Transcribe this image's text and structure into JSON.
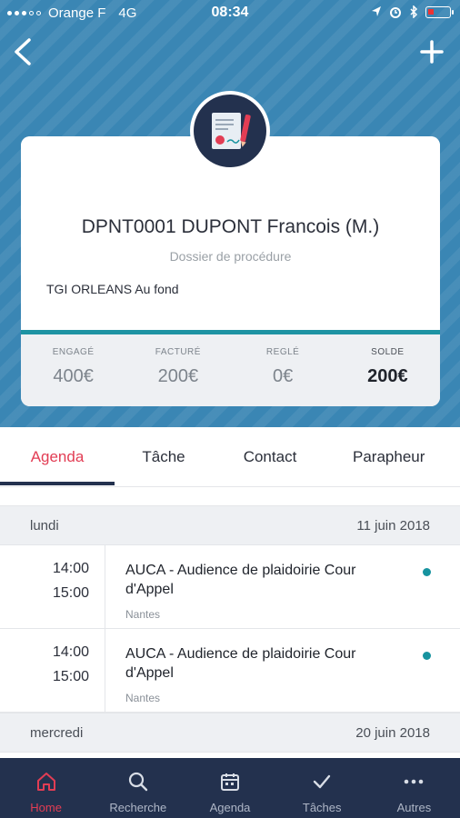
{
  "status_bar": {
    "carrier": "Orange F",
    "network": "4G",
    "time": "08:34"
  },
  "header": {
    "back_icon": "chevron-left-icon",
    "add_icon": "plus-icon",
    "avatar_icon": "document-signature-icon"
  },
  "dossier": {
    "title": "DPNT0001 DUPONT Francois (M.)",
    "type": "Dossier de procédure",
    "court": "TGI ORLEANS Au fond",
    "stats": [
      {
        "label": "ENGAGÉ",
        "value": "400€"
      },
      {
        "label": "FACTURÉ",
        "value": "200€"
      },
      {
        "label": "REGLÉ",
        "value": "0€"
      },
      {
        "label": "SOLDE",
        "value": "200€"
      }
    ]
  },
  "tabs": [
    {
      "label": "Agenda",
      "active": true
    },
    {
      "label": "Tâche"
    },
    {
      "label": "Contact"
    },
    {
      "label": "Parapheur"
    }
  ],
  "agenda": [
    {
      "day": "lundi",
      "date": "11 juin 2018",
      "events": [
        {
          "start": "14:00",
          "end": "15:00",
          "title": "AUCA - Audience de plaidoirie Cour d'Appel",
          "location": "Nantes"
        },
        {
          "start": "14:00",
          "end": "15:00",
          "title": "AUCA - Audience de plaidoirie Cour d'Appel",
          "location": "Nantes"
        }
      ]
    },
    {
      "day": "mercredi",
      "date": "20 juin 2018",
      "events": []
    }
  ],
  "bottom_nav": [
    {
      "label": "Home",
      "icon": "home-icon",
      "active": true
    },
    {
      "label": "Recherche",
      "icon": "search-icon"
    },
    {
      "label": "Agenda",
      "icon": "calendar-icon"
    },
    {
      "label": "Tâches",
      "icon": "check-icon"
    },
    {
      "label": "Autres",
      "icon": "more-icon"
    }
  ],
  "colors": {
    "header_blue": "#3a86b4",
    "navy": "#23314e",
    "accent_red": "#e23d54",
    "teal": "#17939f"
  }
}
